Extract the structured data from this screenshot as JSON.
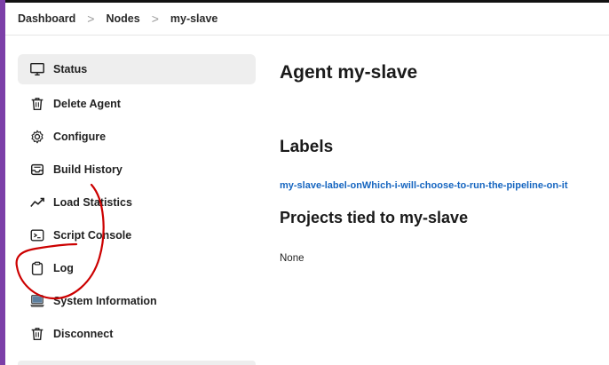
{
  "breadcrumb": {
    "items": [
      "Dashboard",
      "Nodes",
      "my-slave"
    ],
    "separator": ">"
  },
  "sidebar": {
    "items": [
      {
        "label": "Status",
        "icon": "monitor-icon"
      },
      {
        "label": "Delete Agent",
        "icon": "trash-icon"
      },
      {
        "label": "Configure",
        "icon": "gear-icon"
      },
      {
        "label": "Build History",
        "icon": "inbox-icon"
      },
      {
        "label": "Load Statistics",
        "icon": "trend-icon"
      },
      {
        "label": "Script Console",
        "icon": "terminal-icon"
      },
      {
        "label": "Log",
        "icon": "clipboard-icon"
      },
      {
        "label": "System Information",
        "icon": "computer-icon"
      },
      {
        "label": "Disconnect",
        "icon": "trash-icon"
      }
    ]
  },
  "main": {
    "title": "Agent my-slave",
    "labels_heading": "Labels",
    "label_link": "my-slave-label-onWhich-i-will-choose-to-run-the-pipeline-on-it",
    "projects_heading": "Projects tied to my-slave",
    "projects_value": "None"
  },
  "colors": {
    "accent_bar": "#7c3fa8",
    "link": "#1565c0",
    "annotation": "#cc0000",
    "active_bg": "#eeeeee"
  }
}
